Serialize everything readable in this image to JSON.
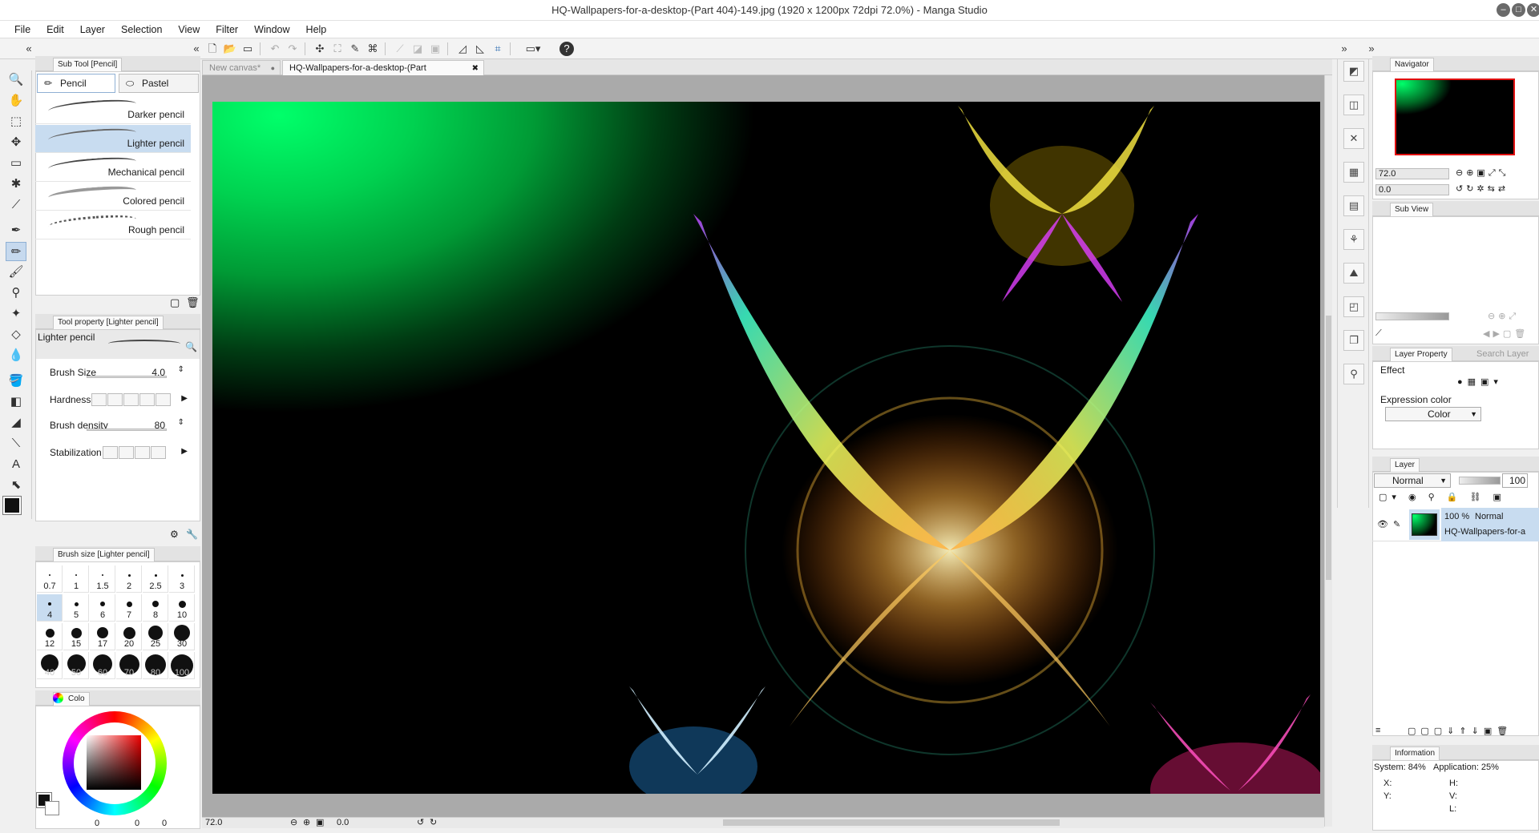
{
  "window": {
    "title": "HQ-Wallpapers-for-a-desktop-(Part 404)-149.jpg (1920 x 1200px 72dpi 72.0%)  - Manga Studio"
  },
  "menu": [
    "File",
    "Edit",
    "Layer",
    "Selection",
    "View",
    "Filter",
    "Window",
    "Help"
  ],
  "doc_tabs": {
    "new_canvas": "New canvas*",
    "active": "HQ-Wallpapers-for-a-desktop-(Part 404)-149.jpg",
    "close": "✖"
  },
  "subtool": {
    "header": "Sub Tool [Pencil]",
    "tabs": [
      "Pencil",
      "Pastel"
    ],
    "items": [
      "Darker pencil",
      "Lighter pencil",
      "Mechanical pencil",
      "Colored pencil",
      "Rough pencil"
    ]
  },
  "tool_property": {
    "header": "Tool property [Lighter pencil]",
    "preset_name": "Lighter pencil",
    "brush_size_label": "Brush Size",
    "brush_size_value": "4.0",
    "hardness_label": "Hardness",
    "brush_density_label": "Brush density",
    "brush_density_value": "80",
    "stabilization_label": "Stabilization"
  },
  "brush_size": {
    "header": "Brush size [Lighter pencil]",
    "sizes": [
      "0.7",
      "1",
      "1.5",
      "2",
      "2.5",
      "3",
      "4",
      "5",
      "6",
      "7",
      "8",
      "10",
      "12",
      "15",
      "17",
      "20",
      "25",
      "30",
      "40",
      "50",
      "60",
      "70",
      "80",
      "100"
    ]
  },
  "color": {
    "tab_label": "Colo",
    "values": [
      "0",
      "0",
      "0"
    ]
  },
  "status": {
    "zoom": "72.0",
    "angle": "0.0"
  },
  "navigator": {
    "header": "Navigator",
    "zoom": "72.0",
    "angle": "0.0"
  },
  "subview": {
    "header": "Sub View"
  },
  "layer_property": {
    "header": "Layer Property",
    "search_tab": "Search Layer",
    "effect_label": "Effect",
    "expression_label": "Expression color",
    "expression_value": "Color"
  },
  "layer": {
    "header": "Layer",
    "blend_mode": "Normal",
    "opacity": "100",
    "row_percent": "100 %",
    "row_mode": "Normal",
    "row_name": "HQ-Wallpapers-for-a"
  },
  "information": {
    "header": "Information",
    "system": "System: 84%",
    "application": "Application: 25%",
    "x_label": "X:",
    "y_label": "Y:",
    "h_label": "H:",
    "v_label": "V:",
    "l_label": "L:"
  },
  "colors": {
    "accent": "#c8dcf0",
    "canvas_green": "#00ff6a",
    "navigator_frame": "#e01010"
  }
}
